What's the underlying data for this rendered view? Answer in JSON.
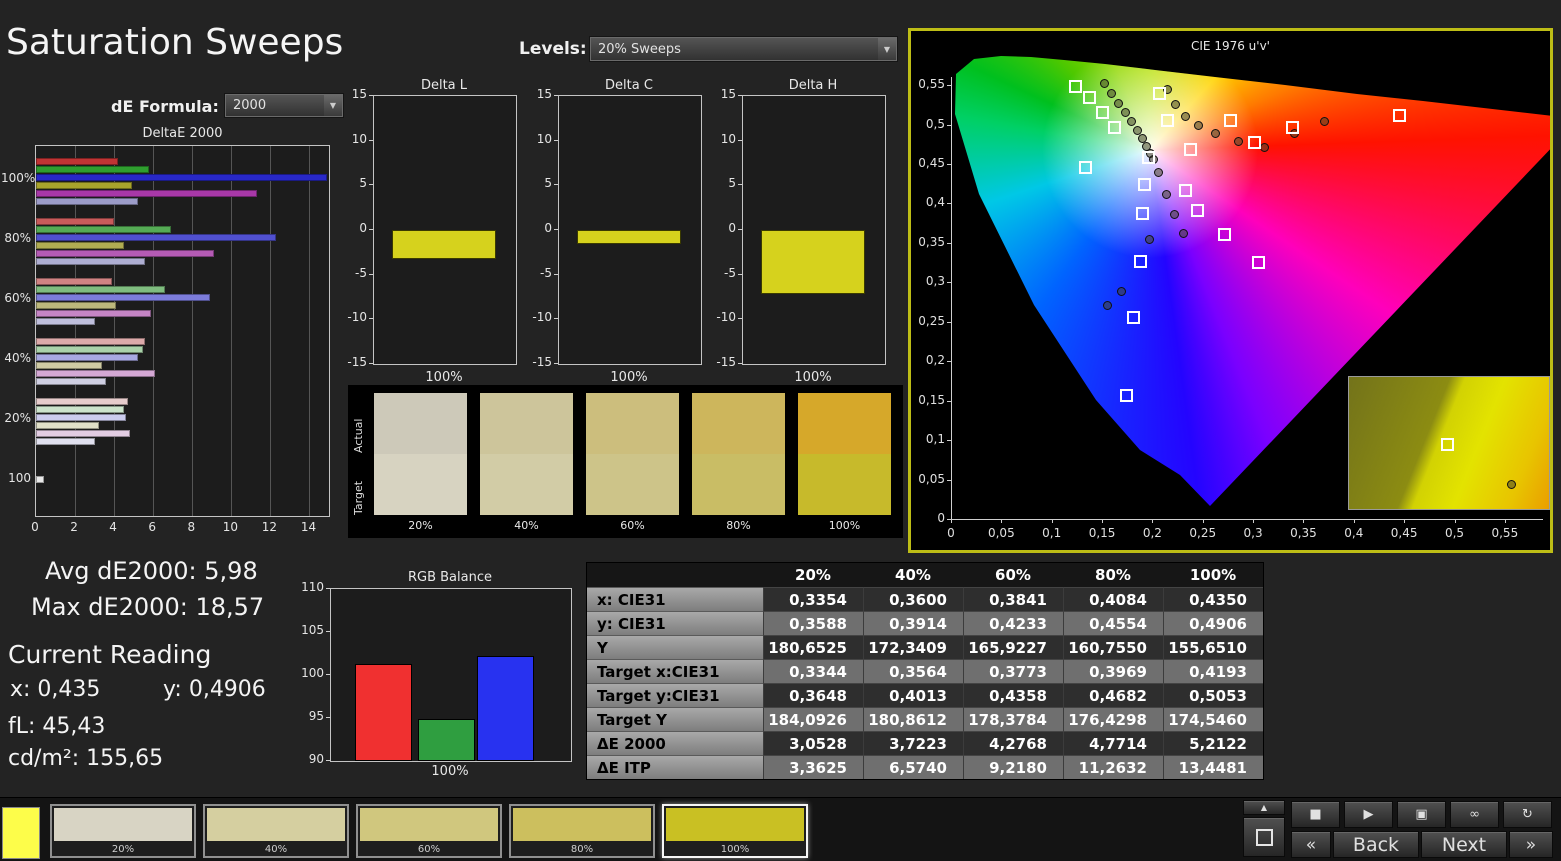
{
  "header": {
    "title": "Saturation Sweeps",
    "de_formula_label": "dE Formula:",
    "de_formula_value": "2000",
    "levels_label": "Levels:",
    "levels_value": "20% Sweeps"
  },
  "stats": {
    "avg": "Avg dE2000: 5,98",
    "max": "Max dE2000: 18,57",
    "current_reading_label": "Current Reading",
    "x": "x: 0,435",
    "y": "y: 0,4906",
    "fl": "fL: 45,43",
    "cdm2": "cd/m²: 155,65"
  },
  "chart_data": [
    {
      "id": "deltae2000",
      "type": "bar",
      "orientation": "horizontal",
      "title": "DeltaE 2000",
      "x_ticks": [
        0,
        2,
        4,
        6,
        8,
        10,
        12,
        14
      ],
      "xlim": [
        0,
        15
      ],
      "groups": [
        {
          "label": "100%",
          "values": [
            4.2,
            5.8,
            14.9,
            4.9,
            11.3,
            5.2
          ],
          "colors": [
            "#c03434",
            "#2f9e2f",
            "#2828c8",
            "#a8a42c",
            "#a838a8",
            "#9c9cc8"
          ]
        },
        {
          "label": "80%",
          "values": [
            4.0,
            6.9,
            12.3,
            4.5,
            9.1,
            5.6
          ],
          "colors": [
            "#c85b5b",
            "#55ab55",
            "#5050d0",
            "#b0ac52",
            "#b55bb5",
            "#aeaed2"
          ]
        },
        {
          "label": "60%",
          "values": [
            3.9,
            6.6,
            8.9,
            4.1,
            5.9,
            3.0
          ],
          "colors": [
            "#d08383",
            "#7fbc7f",
            "#7c7cda",
            "#bcb87c",
            "#c585c5",
            "#bfbfdc"
          ]
        },
        {
          "label": "40%",
          "values": [
            5.6,
            5.5,
            5.2,
            3.4,
            6.1,
            3.6
          ],
          "colors": [
            "#dcaaaa",
            "#aad2aa",
            "#a8a8e2",
            "#cfcba4",
            "#d4a8d4",
            "#cfcfe2"
          ]
        },
        {
          "label": "20%",
          "values": [
            4.7,
            4.5,
            4.6,
            3.2,
            4.8,
            3.0
          ],
          "colors": [
            "#e6cccc",
            "#cce4cc",
            "#ccccee",
            "#e0e0c8",
            "#e2cce2",
            "#e0e0ee"
          ]
        },
        {
          "label": "100",
          "values": [
            0.4
          ],
          "colors": [
            "#e8e8e8"
          ]
        }
      ]
    },
    {
      "id": "delta_l",
      "type": "bar",
      "title": "Delta L",
      "ylim": [
        -15,
        15
      ],
      "y_ticks": [
        15,
        10,
        5,
        0,
        -5,
        -10,
        -15
      ],
      "categories": [
        "100%"
      ],
      "values": [
        -3.2
      ],
      "bar_color": "#d6d21d"
    },
    {
      "id": "delta_c",
      "type": "bar",
      "title": "Delta C",
      "ylim": [
        -15,
        15
      ],
      "y_ticks": [
        15,
        10,
        5,
        0,
        -5,
        -10,
        -15
      ],
      "categories": [
        "100%"
      ],
      "values": [
        -1.6
      ],
      "bar_color": "#d6d21d"
    },
    {
      "id": "delta_h",
      "type": "bar",
      "title": "Delta H",
      "ylim": [
        -15,
        15
      ],
      "y_ticks": [
        15,
        10,
        5,
        0,
        -5,
        -10,
        -15
      ],
      "categories": [
        "100%"
      ],
      "values": [
        -7.2
      ],
      "bar_color": "#d6d21d"
    },
    {
      "id": "rgb_balance",
      "type": "bar",
      "title": "RGB Balance",
      "ylim": [
        90,
        110
      ],
      "y_ticks": [
        110,
        105,
        100,
        95,
        90
      ],
      "categories": [
        "Red",
        "Green",
        "Blue"
      ],
      "values": [
        101.3,
        94.9,
        102.2
      ],
      "colors": [
        "#f03030",
        "#2f9e40",
        "#2832f0"
      ],
      "xlabel": "100%"
    },
    {
      "id": "cie_diagram",
      "type": "scatter",
      "title": "CIE 1976 u'v'",
      "xlim": [
        0,
        0.58
      ],
      "ylim": [
        0,
        0.58
      ],
      "x_ticks": [
        "0",
        "0,05",
        "0,1",
        "0,15",
        "0,2",
        "0,25",
        "0,3",
        "0,35",
        "0,4",
        "0,45",
        "0,5",
        "0,55"
      ],
      "y_ticks": [
        "0,55",
        "0,5",
        "0,45",
        "0,4",
        "0,35",
        "0,3",
        "0,25",
        "0,2",
        "0,15",
        "0,1",
        "0,05",
        "0"
      ],
      "targets_uv": [
        [
          0.123,
          0.55
        ],
        [
          0.137,
          0.535
        ],
        [
          0.149,
          0.516
        ],
        [
          0.161,
          0.498
        ],
        [
          0.206,
          0.541
        ],
        [
          0.214,
          0.506
        ],
        [
          0.237,
          0.47
        ],
        [
          0.277,
          0.506
        ],
        [
          0.3,
          0.479
        ],
        [
          0.338,
          0.497
        ],
        [
          0.444,
          0.513
        ],
        [
          0.133,
          0.447
        ],
        [
          0.195,
          0.46
        ],
        [
          0.191,
          0.425
        ],
        [
          0.232,
          0.418
        ],
        [
          0.189,
          0.389
        ],
        [
          0.244,
          0.392
        ],
        [
          0.271,
          0.362
        ],
        [
          0.187,
          0.327
        ],
        [
          0.304,
          0.326
        ],
        [
          0.18,
          0.257
        ],
        [
          0.173,
          0.158
        ]
      ],
      "measurements_uv": [
        [
          0.151,
          0.553
        ],
        [
          0.158,
          0.541
        ],
        [
          0.165,
          0.528
        ],
        [
          0.172,
          0.516
        ],
        [
          0.178,
          0.505
        ],
        [
          0.184,
          0.494
        ],
        [
          0.189,
          0.484
        ],
        [
          0.193,
          0.474
        ],
        [
          0.197,
          0.465
        ],
        [
          0.2,
          0.457
        ],
        [
          0.214,
          0.546
        ],
        [
          0.222,
          0.526
        ],
        [
          0.232,
          0.512
        ],
        [
          0.245,
          0.5
        ],
        [
          0.262,
          0.49
        ],
        [
          0.285,
          0.48
        ],
        [
          0.31,
          0.472
        ],
        [
          0.34,
          0.49
        ],
        [
          0.37,
          0.505
        ],
        [
          0.205,
          0.44
        ],
        [
          0.213,
          0.413
        ],
        [
          0.221,
          0.387
        ],
        [
          0.23,
          0.363
        ],
        [
          0.196,
          0.355
        ],
        [
          0.168,
          0.29
        ],
        [
          0.154,
          0.272
        ]
      ]
    }
  ],
  "patch_compare": {
    "row_labels": [
      "Actual",
      "Target"
    ],
    "columns": [
      {
        "label": "20%",
        "actual": "#cdc9b9",
        "target": "#d7d3c1"
      },
      {
        "label": "40%",
        "actual": "#cdc59b",
        "target": "#d2cca6"
      },
      {
        "label": "60%",
        "actual": "#ccbe7d",
        "target": "#cdc489"
      },
      {
        "label": "80%",
        "actual": "#cdb65c",
        "target": "#c9bd65"
      },
      {
        "label": "100%",
        "actual": "#d6a82a",
        "target": "#c7ba2b"
      }
    ]
  },
  "table": {
    "columns": [
      "",
      "20%",
      "40%",
      "60%",
      "80%",
      "100%"
    ],
    "rows": [
      {
        "label": "x: CIE31",
        "values": [
          "0,3354",
          "0,3600",
          "0,3841",
          "0,4084",
          "0,4350"
        ]
      },
      {
        "label": "y: CIE31",
        "values": [
          "0,3588",
          "0,3914",
          "0,4233",
          "0,4554",
          "0,4906"
        ]
      },
      {
        "label": "Y",
        "values": [
          "180,6525",
          "172,3409",
          "165,9227",
          "160,7550",
          "155,6510"
        ]
      },
      {
        "label": "Target x:CIE31",
        "values": [
          "0,3344",
          "0,3564",
          "0,3773",
          "0,3969",
          "0,4193"
        ]
      },
      {
        "label": "Target y:CIE31",
        "values": [
          "0,3648",
          "0,4013",
          "0,4358",
          "0,4682",
          "0,5053"
        ]
      },
      {
        "label": "Target Y",
        "values": [
          "184,0926",
          "180,8612",
          "178,3784",
          "176,4298",
          "174,5460"
        ]
      },
      {
        "label": "ΔE 2000",
        "values": [
          "3,0528",
          "3,7223",
          "4,2768",
          "4,7714",
          "5,2122"
        ]
      },
      {
        "label": "ΔE ITP",
        "values": [
          "3,3625",
          "6,5740",
          "9,2180",
          "11,2632",
          "13,4481"
        ]
      }
    ]
  },
  "bottom_bar": {
    "current_color": "#fdfd4a",
    "patches": [
      {
        "label": "20%",
        "color": "#d8d4c4",
        "selected": false
      },
      {
        "label": "40%",
        "color": "#d5cfa0",
        "selected": false
      },
      {
        "label": "60%",
        "color": "#d0c77e",
        "selected": false
      },
      {
        "label": "80%",
        "color": "#ccbf5e",
        "selected": false
      },
      {
        "label": "100%",
        "color": "#c9c023",
        "selected": true
      }
    ],
    "controls": {
      "up_icon": "▲",
      "transport": [
        {
          "name": "stop-icon",
          "glyph": "■"
        },
        {
          "name": "play-icon",
          "glyph": "▶"
        },
        {
          "name": "pattern-icon",
          "glyph": "▣"
        },
        {
          "name": "loop-icon",
          "glyph": "∞"
        },
        {
          "name": "refresh-icon",
          "glyph": "↻"
        }
      ],
      "prev_symbol": "«",
      "back_label": "Back",
      "next_label": "Next",
      "forward_symbol": "»"
    }
  }
}
